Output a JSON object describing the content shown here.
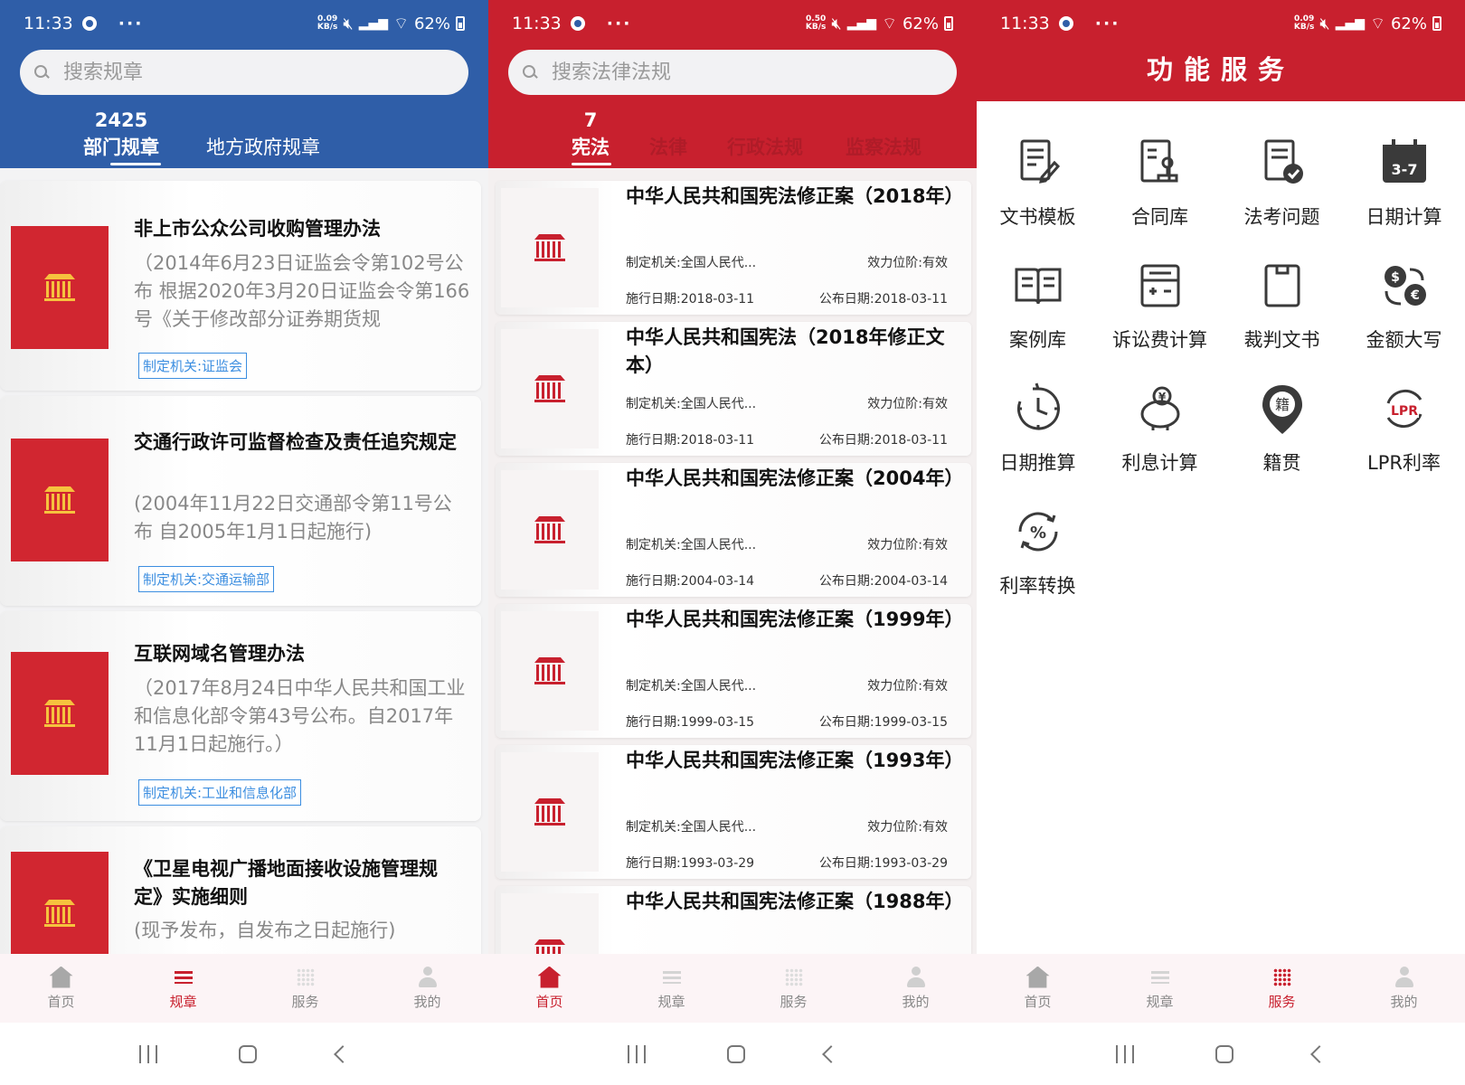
{
  "status_bar": {
    "time": "11:33",
    "more": "···",
    "battery": "62%",
    "speeds": [
      "0.09\nKB/s",
      "0.50\nKB/s",
      "0.09\nKB/s"
    ]
  },
  "screen1": {
    "search_placeholder": "搜索规章",
    "tabs": [
      {
        "count": "2425",
        "label": "部门规章"
      },
      {
        "label": "地方政府规章"
      }
    ],
    "items": [
      {
        "title": "非上市公众公司收购管理办法",
        "desc": "（2014年6月23日证监会令第102号公布 根据2020年3月20日证监会令第166号《关于修改部分证券期货规",
        "tag": "制定机关:证监会"
      },
      {
        "title": "交通行政许可监督检查及责任追究规定",
        "desc": "(2004年11月22日交通部令第11号公布 自2005年1月1日起施行)",
        "tag": "制定机关:交通运输部"
      },
      {
        "title": "互联网域名管理办法",
        "desc": "（2017年8月24日中华人民共和国工业和信息化部令第43号公布。自2017年11月1日起施行。）",
        "tag": "制定机关:工业和信息化部"
      },
      {
        "title": "《卫星电视广播地面接收设施管理规定》实施细则",
        "desc": "(现予发布，自发布之日起施行)"
      }
    ]
  },
  "screen2": {
    "search_placeholder": "搜索法律法规",
    "tabs": [
      {
        "count": "7",
        "label": "宪法"
      },
      {
        "label": "法律"
      },
      {
        "label": "行政法规"
      },
      {
        "label": "监察法规"
      }
    ],
    "items": [
      {
        "title": "中华人民共和国宪法修正案（2018年）",
        "org": "制定机关:全国人民代...",
        "level": "效力位阶:有效",
        "effective": "施行日期:2018-03-11",
        "published": "公布日期:2018-03-11"
      },
      {
        "title": "中华人民共和国宪法（2018年修正文本）",
        "org": "制定机关:全国人民代...",
        "level": "效力位阶:有效",
        "effective": "施行日期:2018-03-11",
        "published": "公布日期:2018-03-11"
      },
      {
        "title": "中华人民共和国宪法修正案（2004年）",
        "org": "制定机关:全国人民代...",
        "level": "效力位阶:有效",
        "effective": "施行日期:2004-03-14",
        "published": "公布日期:2004-03-14"
      },
      {
        "title": "中华人民共和国宪法修正案（1999年）",
        "org": "制定机关:全国人民代...",
        "level": "效力位阶:有效",
        "effective": "施行日期:1999-03-15",
        "published": "公布日期:1999-03-15"
      },
      {
        "title": "中华人民共和国宪法修正案（1993年）",
        "org": "制定机关:全国人民代...",
        "level": "效力位阶:有效",
        "effective": "施行日期:1993-03-29",
        "published": "公布日期:1993-03-29"
      },
      {
        "title": "中华人民共和国宪法修正案（1988年）"
      }
    ]
  },
  "screen3": {
    "title": "功能服务",
    "services": [
      {
        "label": "文书模板",
        "icon": "document-edit-icon"
      },
      {
        "label": "合同库",
        "icon": "contract-stamp-icon"
      },
      {
        "label": "法考问题",
        "icon": "exam-check-icon"
      },
      {
        "label": "日期计算",
        "icon": "calendar-icon"
      },
      {
        "label": "案例库",
        "icon": "open-book-icon"
      },
      {
        "label": "诉讼费计算",
        "icon": "calculator-icon"
      },
      {
        "label": "裁判文书",
        "icon": "clipboard-icon"
      },
      {
        "label": "金额大写",
        "icon": "currency-exchange-icon"
      },
      {
        "label": "日期推算",
        "icon": "clock-icon"
      },
      {
        "label": "利息计算",
        "icon": "piggy-bank-icon"
      },
      {
        "label": "籍贯",
        "icon": "location-pin-icon"
      },
      {
        "label": "LPR利率",
        "icon": "lpr-icon"
      },
      {
        "label": "利率转换",
        "icon": "rate-convert-icon"
      }
    ],
    "pin_char": "籍"
  },
  "bottom_nav": [
    "首页",
    "规章",
    "服务",
    "我的"
  ],
  "colors": {
    "blue": "#2f5ea8",
    "red": "#c8202e",
    "gold": "#f6c23e",
    "tag_blue": "#3c8ee0"
  }
}
